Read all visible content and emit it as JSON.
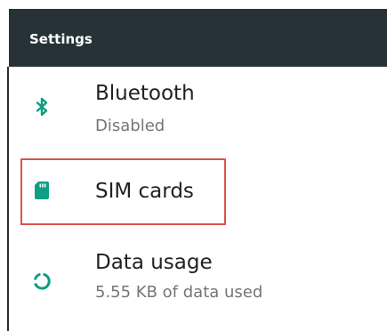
{
  "header": {
    "title": "Settings",
    "background": "#263238"
  },
  "accent_color": "#0f9d83",
  "highlight_color": "#d9534f",
  "items": [
    {
      "label": "Bluetooth",
      "summary": "Disabled",
      "icon": "bluetooth-icon"
    },
    {
      "label": "SIM cards",
      "summary": "",
      "icon": "sim-card-icon"
    },
    {
      "label": "Data usage",
      "summary": "5.55 KB of data used",
      "icon": "data-usage-icon"
    }
  ]
}
